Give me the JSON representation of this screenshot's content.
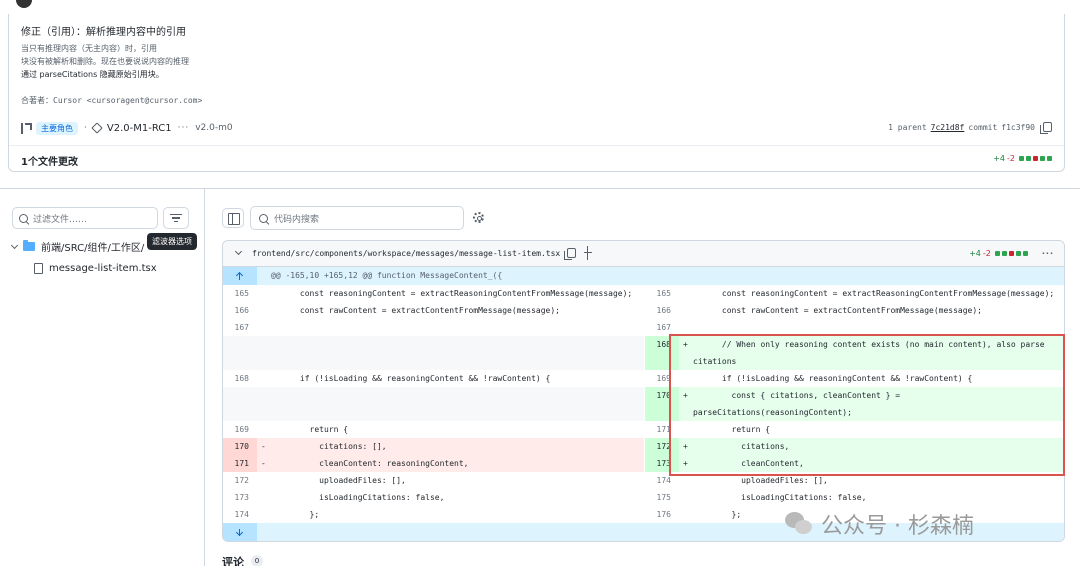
{
  "header": {
    "author_partial": ""
  },
  "commit": {
    "title": "修正（引用）：解析推理内容中的引用",
    "body_lines": [
      "当只有推理内容（无主内容）时，引用",
      "块没有被解析和删除。现在也要说说内容的推理",
      "通过 parseCitations 隐藏原始引用块。"
    ],
    "coauthor": "合著者：Cursor <cursoragent@cursor.com>",
    "branch_badge": "主要角色",
    "tag_main": "V2.0-M1-RC1",
    "tag_more": "···",
    "tag_secondary": "v2.0-m0",
    "parent_label": "1 parent",
    "parent_sha": "7c21d8f",
    "commit_label": "commit",
    "commit_sha": "f1c3f90",
    "files_changed": "1个文件更改",
    "additions": "+4",
    "deletions": "-2"
  },
  "sidebar": {
    "filter_placeholder": "过滤文件……",
    "filter_tooltip": "滤波器选项",
    "folder": "前端/SRC/组件/工作区/",
    "file": "message-list-item.tsx"
  },
  "toolbar": {
    "code_search_placeholder": "代码内搜索"
  },
  "diff": {
    "file_path": "frontend/src/components/workspace/messages/message-list-item.tsx",
    "additions": "+4",
    "deletions": "-2",
    "more": "···",
    "hunk_header": "@@ -165,10 +165,12 @@ function MessageContent_({",
    "left": [
      {
        "n": "165",
        "marker": "",
        "code": "      const reasoningContent = extractReasoningContentFromMessage(message);"
      },
      {
        "n": "166",
        "marker": "",
        "code": "      const rawContent = extractContentFromMessage(message);"
      },
      {
        "n": "167",
        "marker": "",
        "code": ""
      },
      {
        "n": "",
        "marker": "",
        "code": ""
      },
      {
        "n": "168",
        "marker": "",
        "code": "      if (!isLoading && reasoningContent && !rawContent) {"
      },
      {
        "n": "",
        "marker": "",
        "code": ""
      },
      {
        "n": "169",
        "marker": "",
        "code": "        return {"
      },
      {
        "n": "170",
        "marker": "-",
        "code": "          citations: [],"
      },
      {
        "n": "171",
        "marker": "-",
        "code": "          cleanContent: reasoningContent,"
      },
      {
        "n": "172",
        "marker": "",
        "code": "          uploadedFiles: [],"
      },
      {
        "n": "173",
        "marker": "",
        "code": "          isLoadingCitations: false,"
      },
      {
        "n": "174",
        "marker": "",
        "code": "        };"
      }
    ],
    "right": [
      {
        "n": "165",
        "marker": "",
        "code": "      const reasoningContent = extractReasoningContentFromMessage(message);"
      },
      {
        "n": "166",
        "marker": "",
        "code": "      const rawContent = extractContentFromMessage(message);"
      },
      {
        "n": "167",
        "marker": "",
        "code": ""
      },
      {
        "n": "168",
        "marker": "+",
        "code": "      // When only reasoning content exists (no main content), also parse citations"
      },
      {
        "n": "169",
        "marker": "",
        "code": "      if (!isLoading && reasoningContent && !rawContent) {"
      },
      {
        "n": "170",
        "marker": "+",
        "code": "        const { citations, cleanContent } = parseCitations(reasoningContent);"
      },
      {
        "n": "171",
        "marker": "",
        "code": "        return {"
      },
      {
        "n": "172",
        "marker": "+",
        "code": "          citations,"
      },
      {
        "n": "173",
        "marker": "+",
        "code": "          cleanContent,"
      },
      {
        "n": "174",
        "marker": "",
        "code": "          uploadedFiles: [],"
      },
      {
        "n": "175",
        "marker": "",
        "code": "          isLoadingCitations: false,"
      },
      {
        "n": "176",
        "marker": "",
        "code": "        };"
      }
    ]
  },
  "comments": {
    "label": "评论",
    "count": "0"
  },
  "watermark": "公众号 · 杉森楠",
  "colors": {
    "add_bg": "#e6ffec",
    "del_bg": "#ffebe9",
    "accent": "#0969da",
    "highlight_box": "#d9534f"
  }
}
